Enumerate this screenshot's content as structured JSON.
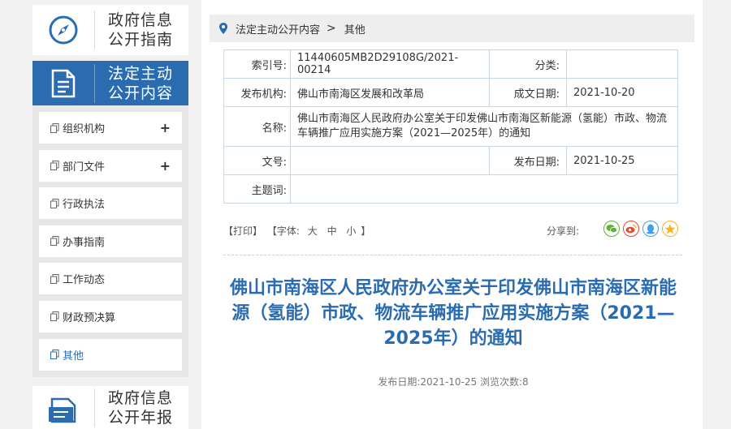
{
  "sidebar": {
    "guide_card": {
      "line1": "政府信息",
      "line2": "公开指南"
    },
    "active_card": {
      "line1": "法定主动",
      "line2": "公开内容"
    },
    "annual_card": {
      "line1": "政府信息",
      "line2": "公开年报"
    },
    "menu": [
      {
        "label": "组织机构",
        "expand": "+"
      },
      {
        "label": "部门文件",
        "expand": "+"
      },
      {
        "label": "行政执法"
      },
      {
        "label": "办事指南"
      },
      {
        "label": "工作动态"
      },
      {
        "label": "财政预决算"
      },
      {
        "label": "其他",
        "active": true
      }
    ]
  },
  "breadcrumb": {
    "parent": "法定主动公开内容",
    "separator": ">",
    "current": "其他"
  },
  "info_table": {
    "index_label": "索引号:",
    "index_value": "11440605MB2D29108G/2021-00214",
    "category_label": "分类:",
    "category_value": "",
    "publisher_label": "发布机构:",
    "publisher_value": "佛山市南海区发展和改革局",
    "created_label": "成文日期:",
    "created_value": "2021-10-20",
    "name_label": "名称:",
    "name_value": "佛山市南海区人民政府办公室关于印发佛山市南海区新能源（氢能）市政、物流车辆推广应用实施方案（2021—2025年）的通知",
    "docno_label": "文号:",
    "docno_value": "",
    "publish_label": "发布日期:",
    "publish_value": "2021-10-25",
    "keywords_label": "主题词:",
    "keywords_value": ""
  },
  "toolbar": {
    "print": "【打印】",
    "font_prefix": "【字体:",
    "font_large": "大",
    "font_medium": "中",
    "font_small": "小",
    "font_suffix": "】",
    "share_label": "分享到:"
  },
  "article": {
    "title": "佛山市南海区人民政府办公室关于印发佛山市南海区新能源（氢能）市政、物流车辆推广应用实施方案（2021—2025年）的通知",
    "meta": "发布日期:2021-10-25  浏览次数:8"
  },
  "colors": {
    "accent": "#2b6cb0",
    "wechat": "#5fb336",
    "weibo": "#e6492d",
    "qq": "#3ea0e8",
    "qzone": "#f5b423"
  }
}
